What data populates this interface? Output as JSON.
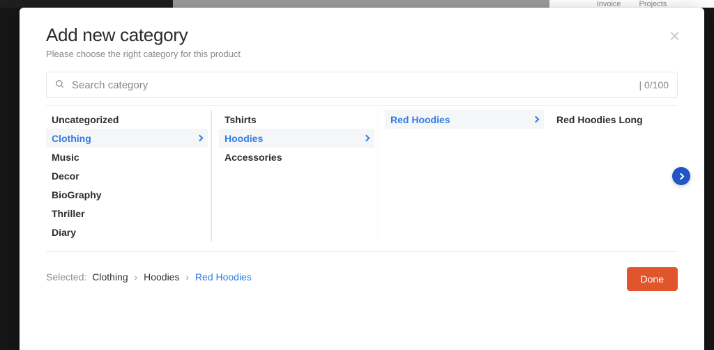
{
  "nav_bg": {
    "item1": "Invoice",
    "item2": "Projects"
  },
  "modal": {
    "title": "Add new category",
    "subtitle": "Please choose the right category for this product"
  },
  "search": {
    "placeholder": "Search category",
    "counter": "|   0/100"
  },
  "columns": {
    "col1": [
      {
        "label": "Uncategorized",
        "active": false,
        "has_children": false
      },
      {
        "label": "Clothing",
        "active": true,
        "has_children": true
      },
      {
        "label": "Music",
        "active": false,
        "has_children": false
      },
      {
        "label": "Decor",
        "active": false,
        "has_children": false
      },
      {
        "label": "BioGraphy",
        "active": false,
        "has_children": false
      },
      {
        "label": "Thriller",
        "active": false,
        "has_children": false
      },
      {
        "label": "Diary",
        "active": false,
        "has_children": false
      }
    ],
    "col2": [
      {
        "label": "Tshirts",
        "active": false,
        "has_children": false
      },
      {
        "label": "Hoodies",
        "active": true,
        "has_children": true
      },
      {
        "label": "Accessories",
        "active": false,
        "has_children": false
      }
    ],
    "col3": [
      {
        "label": "Red Hoodies",
        "active": true,
        "has_children": true
      }
    ],
    "col4": [
      {
        "label": "Red Hoodies Long",
        "active": false,
        "has_children": false
      }
    ]
  },
  "breadcrumb": {
    "label": "Selected:",
    "parts": [
      "Clothing",
      "Hoodies",
      "Red Hoodies"
    ]
  },
  "actions": {
    "done": "Done"
  }
}
